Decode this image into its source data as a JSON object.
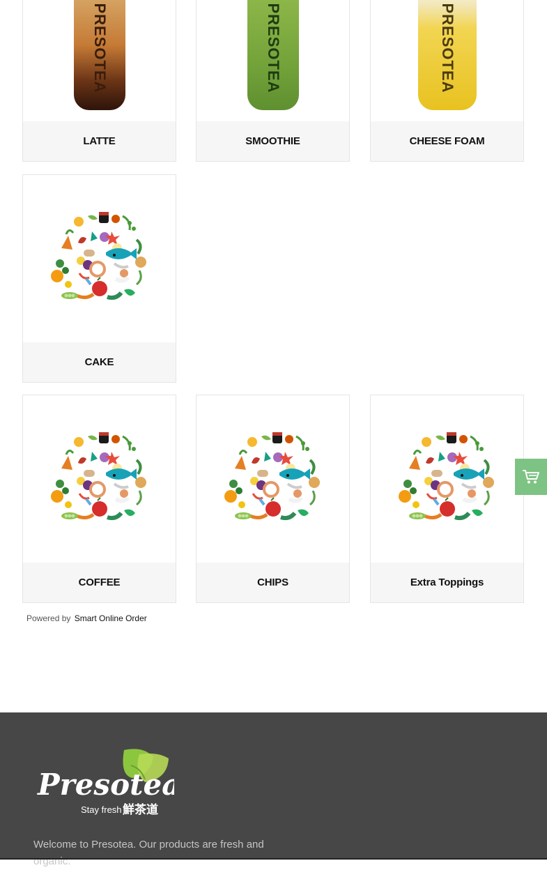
{
  "categories": [
    {
      "label": "LATTE",
      "icon": "latte-cup-icon"
    },
    {
      "label": "SMOOTHIE",
      "icon": "smoothie-cup-icon"
    },
    {
      "label": "CHEESE FOAM",
      "icon": "cheese-foam-cup-icon"
    },
    {
      "label": "CAKE",
      "icon": "food-collage-icon"
    },
    {
      "label": "COFFEE",
      "icon": "food-collage-icon"
    },
    {
      "label": "CHIPS",
      "icon": "food-collage-icon"
    },
    {
      "label": "Extra Toppings",
      "icon": "food-collage-icon"
    }
  ],
  "cup_brand": "PRESOTEA",
  "powered": {
    "prefix": "Powered by",
    "link": "Smart Online Order"
  },
  "footer": {
    "logo_text": "Presotea",
    "tagline": "Stay fresh",
    "tagline_cn": "鮮茶道",
    "welcome": "Welcome to Presotea. Our products are fresh and organic."
  },
  "cart": {
    "icon": "cart-icon"
  },
  "colors": {
    "accent_green": "#7dc383",
    "footer_bg": "#474747",
    "label_bg": "#f6f6f6"
  }
}
